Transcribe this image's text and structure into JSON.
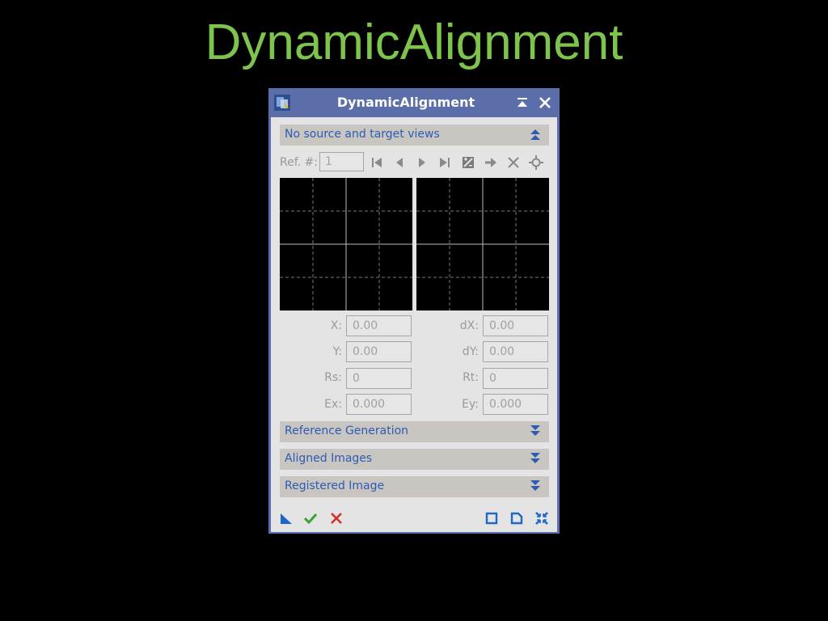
{
  "page_title": "DynamicAlignment",
  "window": {
    "title": "DynamicAlignment",
    "shade_button": "⌅",
    "close_button": "✕"
  },
  "top_section": {
    "label": "No source and target views",
    "state": "expanded"
  },
  "reference": {
    "label": "Ref. #:",
    "value": "1"
  },
  "navigation_icons": [
    "first-icon",
    "previous-icon",
    "next-icon",
    "last-icon",
    "auto-icon",
    "arrow-right-icon",
    "delete-icon",
    "crosshair-icon"
  ],
  "fields": {
    "x": {
      "label": "X:",
      "value": "0.00"
    },
    "y": {
      "label": "Y:",
      "value": "0.00"
    },
    "rs": {
      "label": "Rs:",
      "value": "0"
    },
    "ex": {
      "label": "Ex:",
      "value": "0.000"
    },
    "dx": {
      "label": "dX:",
      "value": "0.00"
    },
    "dy": {
      "label": "dY:",
      "value": "0.00"
    },
    "rt": {
      "label": "Rt:",
      "value": "0"
    },
    "ey": {
      "label": "Ey:",
      "value": "0.000"
    }
  },
  "sections": [
    {
      "label": "Reference Generation",
      "state": "collapsed"
    },
    {
      "label": "Aligned Images",
      "state": "collapsed"
    },
    {
      "label": "Registered Image",
      "state": "collapsed"
    }
  ],
  "colors": {
    "title_green": "#7dc34c",
    "window_frame": "#5b6ea9",
    "section_text": "#2c5bb6",
    "section_bg": "#c9c6c1",
    "ok_green": "#3aa03a",
    "cancel_red": "#d03030",
    "icon_blue": "#1f66c9"
  }
}
